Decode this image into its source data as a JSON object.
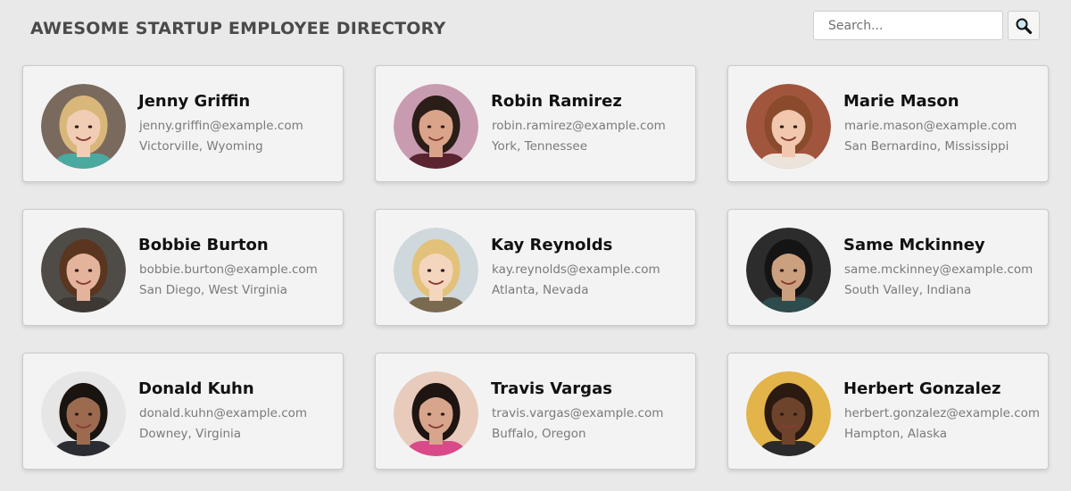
{
  "header": {
    "title": "AWESOME STARTUP EMPLOYEE DIRECTORY",
    "search_placeholder": "Search...",
    "search_icon": "magnifying-glass-icon"
  },
  "employees": [
    {
      "name": "Jenny Griffin",
      "email": "jenny.griffin@example.com",
      "location": "Victorville, Wyoming",
      "skin": "#f0cdb4",
      "hair": "#d9b77a",
      "bg": "#7a6a5e",
      "shirt": "#4aa9a1"
    },
    {
      "name": "Robin Ramirez",
      "email": "robin.ramirez@example.com",
      "location": "York, Tennessee",
      "skin": "#d9a48a",
      "hair": "#2b1d18",
      "bg": "#c99bb0",
      "shirt": "#5a2430"
    },
    {
      "name": "Marie Mason",
      "email": "marie.mason@example.com",
      "location": "San Bernardino, Mississippi",
      "skin": "#f1c7ad",
      "hair": "#8a4a2c",
      "bg": "#a0553c",
      "shirt": "#ece3db"
    },
    {
      "name": "Bobbie Burton",
      "email": "bobbie.burton@example.com",
      "location": "San Diego, West Virginia",
      "skin": "#e3b39b",
      "hair": "#5a3520",
      "bg": "#4f4b47",
      "shirt": "#3d3834"
    },
    {
      "name": "Kay Reynolds",
      "email": "kay.reynolds@example.com",
      "location": "Atlanta, Nevada",
      "skin": "#f4d6bf",
      "hair": "#e2c27a",
      "bg": "#cfd8dc",
      "shirt": "#7a6a50"
    },
    {
      "name": "Same Mckinney",
      "email": "same.mckinney@example.com",
      "location": "South Valley, Indiana",
      "skin": "#caa07f",
      "hair": "#141414",
      "bg": "#2c2c2c",
      "shirt": "#2e4b4d"
    },
    {
      "name": "Donald Kuhn",
      "email": "donald.kuhn@example.com",
      "location": "Downey, Virginia",
      "skin": "#9c6b4f",
      "hair": "#1a1410",
      "bg": "#e6e6e6",
      "shirt": "#2b2d33"
    },
    {
      "name": "Travis Vargas",
      "email": "travis.vargas@example.com",
      "location": "Buffalo, Oregon",
      "skin": "#d6a58c",
      "hair": "#1e1512",
      "bg": "#e8cbbb",
      "shirt": "#d94a8a"
    },
    {
      "name": "Herbert Gonzalez",
      "email": "herbert.gonzalez@example.com",
      "location": "Hampton, Alaska",
      "skin": "#6e432c",
      "hair": "#2a1a12",
      "bg": "#e2b44a",
      "shirt": "#2a2a2a"
    }
  ]
}
